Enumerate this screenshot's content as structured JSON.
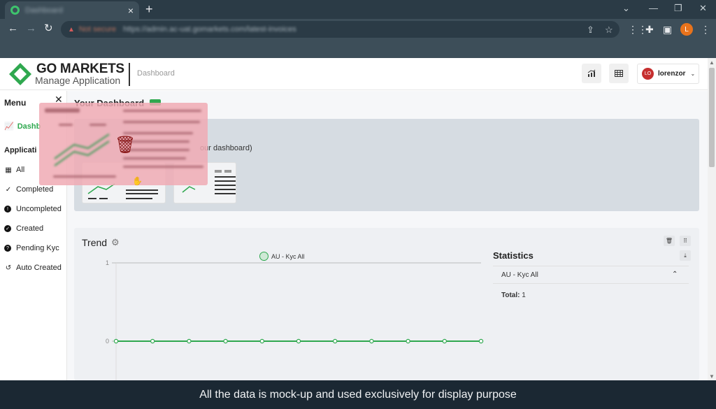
{
  "browser": {
    "tab_title": "Dashboard",
    "omnibox_status": "Not secure",
    "url": "https://admin.ac-uat.gomarkets.com/latest-invoices",
    "profile_initial": "L"
  },
  "header": {
    "brand": "GO MARKETS",
    "subtitle": "Manage Application",
    "breadcrumb": "Dashboard",
    "user_initials": "LO",
    "user_name": "lorenzor"
  },
  "sidebar": {
    "title": "Menu",
    "dashboard_label": "Dashb",
    "section_label": "Applicati",
    "items": [
      {
        "label": "All",
        "icon": "table-icon"
      },
      {
        "label": "Completed",
        "icon": "check-icon"
      },
      {
        "label": "Uncompleted",
        "icon": "exclamation-icon"
      },
      {
        "label": "Created",
        "icon": "check-circle-icon"
      },
      {
        "label": "Pending Kyc",
        "icon": "question-icon"
      },
      {
        "label": "Auto Created",
        "icon": "history-icon"
      }
    ]
  },
  "dashboard": {
    "title": "Your Dashboard",
    "info_text": "our dashboard)"
  },
  "trend": {
    "title": "Trend",
    "legend": "AU - Kyc All",
    "statistics_title": "Statistics",
    "stats_label": "AU - Kyc All",
    "total_label": "Total:",
    "total_value": "1"
  },
  "chart_data": {
    "type": "line",
    "series": [
      {
        "name": "AU - Kyc All",
        "values": [
          0,
          0,
          0,
          0,
          0,
          0,
          0,
          0,
          0,
          0,
          0
        ]
      }
    ],
    "y_ticks": [
      "1",
      "0"
    ],
    "ylim": [
      0,
      1
    ],
    "grid": true,
    "legend_position": "top-center"
  },
  "footer": {
    "caption": "All the data is mock-up and used exclusively for display purpose"
  },
  "colors": {
    "accent": "#2fa84f",
    "browser_frame": "#2b3b46",
    "caption_bg": "#1b2833"
  }
}
